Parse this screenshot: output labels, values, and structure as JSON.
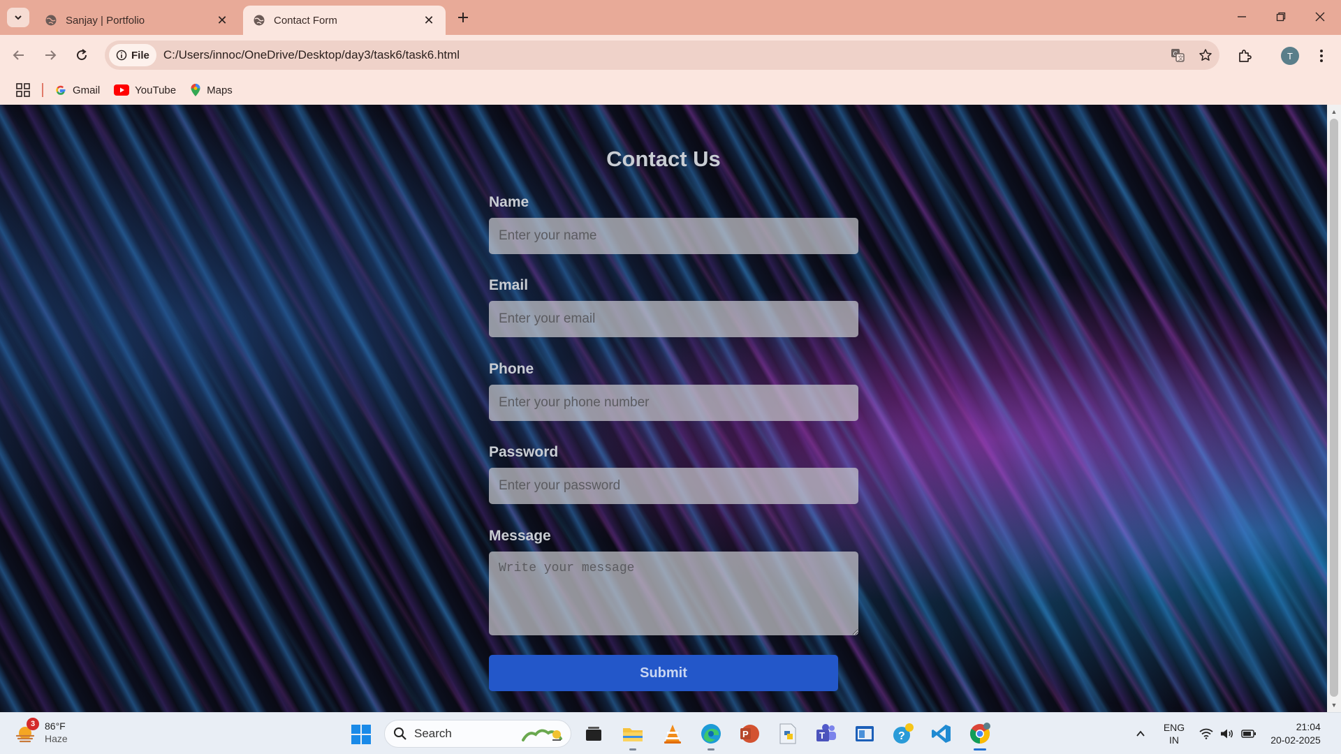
{
  "browser": {
    "tabs": [
      {
        "title": "Sanjay | Portfolio",
        "active": false
      },
      {
        "title": "Contact Form",
        "active": true
      }
    ],
    "address_chip": "File",
    "url": "C:/Users/innoc/OneDrive/Desktop/day3/task6/task6.html",
    "profile_initial": "T",
    "bookmarks": [
      {
        "label": "Gmail",
        "icon": "gmail-icon"
      },
      {
        "label": "YouTube",
        "icon": "youtube-icon"
      },
      {
        "label": "Maps",
        "icon": "maps-icon"
      }
    ]
  },
  "form": {
    "title": "Contact Us",
    "fields": [
      {
        "label": "Name",
        "placeholder": "Enter your name"
      },
      {
        "label": "Email",
        "placeholder": "Enter your email"
      },
      {
        "label": "Phone",
        "placeholder": "Enter your phone number"
      },
      {
        "label": "Password",
        "placeholder": "Enter your password"
      }
    ],
    "message": {
      "label": "Message",
      "placeholder": "Write your message"
    },
    "submit_label": "Submit"
  },
  "taskbar": {
    "weather": {
      "temp": "86°F",
      "condition": "Haze",
      "badge": "3"
    },
    "search_label": "Search",
    "tray": {
      "lang_line1": "ENG",
      "lang_line2": "IN",
      "time": "21:04",
      "date": "20-02-2025"
    }
  },
  "colors": {
    "tabbar": "#e8aa98",
    "toolbar": "#fbe6df",
    "submit": "#2357c9",
    "label_text": "#c9cdd3"
  }
}
